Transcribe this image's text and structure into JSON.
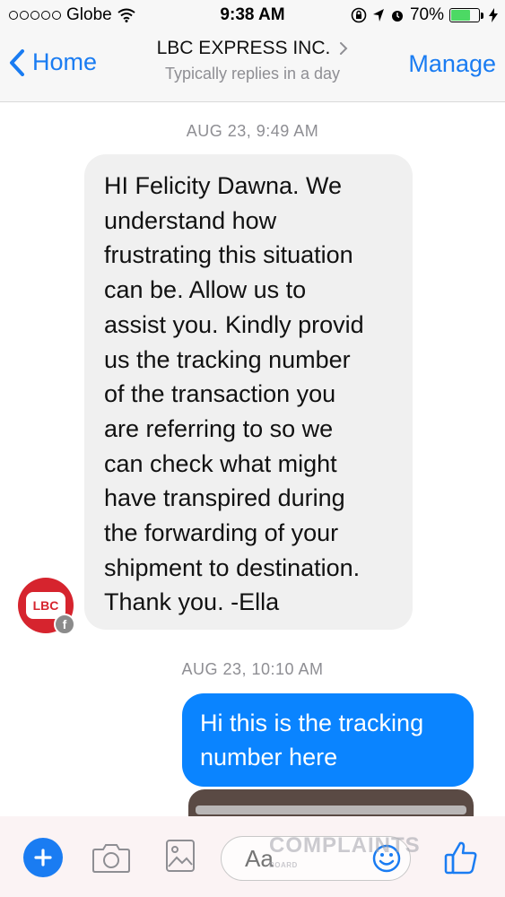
{
  "status_bar": {
    "carrier": "Globe",
    "time": "9:38 AM",
    "battery": "70%",
    "battery_level": 0.7
  },
  "nav": {
    "back_label": "Home",
    "title": "LBC EXPRESS INC.",
    "subtitle": "Typically replies in a day",
    "manage_label": "Manage"
  },
  "messages": [
    {
      "timestamp": "AUG 23, 9:49 AM",
      "lines": [
        "HI Felicity Dawna. We",
        "understand how",
        "frustrating this situation",
        "can be. Allow us to",
        "assist you. Kindly provid",
        "us the tracking number",
        "of the transaction you",
        "are referring to so we",
        "can check what might",
        "have transpired during",
        "the forwarding of your",
        "shipment to destination.",
        "Thank you. -Ella"
      ],
      "avatar_text": "LBC"
    },
    {
      "timestamp": "AUG 23, 10:10 AM",
      "lines": [
        "Hi this is the tracking",
        "number here"
      ]
    }
  ],
  "composer": {
    "placeholder": "Aa"
  },
  "watermark": {
    "title": "COMPLAINTS",
    "subtitle": "BOARD"
  },
  "colors": {
    "accent": "#1a7cf2",
    "outgoing_bubble": "#0a84ff",
    "incoming_bubble": "#f0f0f0",
    "avatar": "#d6242e"
  }
}
